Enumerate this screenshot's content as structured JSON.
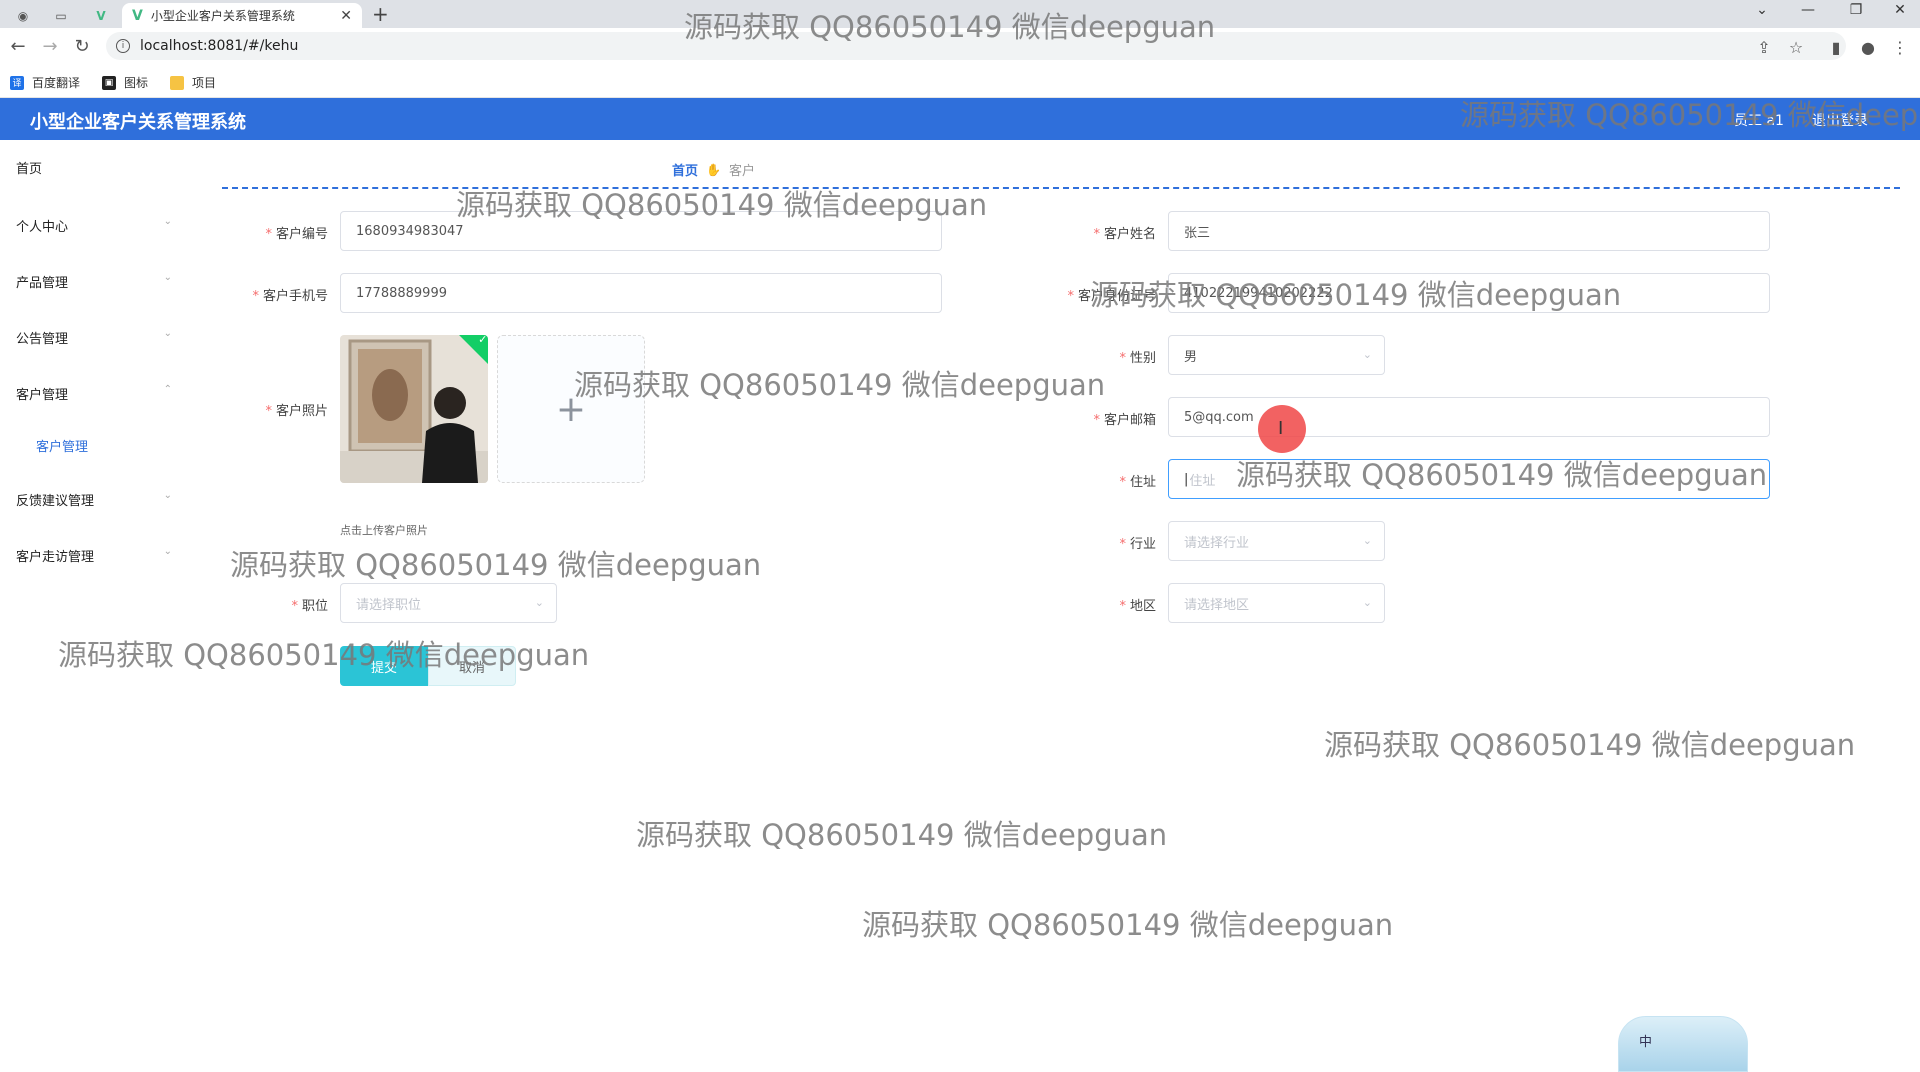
{
  "browser": {
    "tab_title": "小型企业客户关系管理系统",
    "url": "localhost:8081/#/kehu",
    "bookmarks": [
      {
        "label": "百度翻译",
        "icon": "translate-icon",
        "color": "#1f72e8"
      },
      {
        "label": "图标",
        "icon": "iconfont-icon",
        "color": "#222222"
      },
      {
        "label": "项目",
        "icon": "folder-icon",
        "color": "#f6c343"
      }
    ]
  },
  "app": {
    "title": "小型企业客户关系管理系统",
    "user": "员工 a1",
    "logout": "退出登录",
    "accent": "#2f6fdb"
  },
  "sidebar": {
    "items": [
      {
        "label": "首页"
      },
      {
        "label": "个人中心"
      },
      {
        "label": "产品管理"
      },
      {
        "label": "公告管理"
      },
      {
        "label": "客户管理"
      },
      {
        "label": "客户管理"
      },
      {
        "label": "反馈建议管理"
      },
      {
        "label": "客户走访管理"
      }
    ]
  },
  "breadcrumb": {
    "home": "首页",
    "current": "客户"
  },
  "form": {
    "customer_no": {
      "label": "客户编号",
      "value": "1680934983047"
    },
    "customer_name": {
      "label": "客户姓名",
      "value": "张三"
    },
    "phone": {
      "label": "客户手机号",
      "value": "17788889999"
    },
    "id_card": {
      "label": "客户身份证号",
      "value": "410222199410202222"
    },
    "gender": {
      "label": "性别",
      "value": "男"
    },
    "photo": {
      "label": "客户照片",
      "hint": "点击上传客户照片"
    },
    "email": {
      "label": "客户邮箱",
      "value": "5@qq.com"
    },
    "address": {
      "label": "住址",
      "placeholder": "住址"
    },
    "industry": {
      "label": "行业",
      "placeholder": "请选择行业"
    },
    "position": {
      "label": "职位",
      "placeholder": "请选择职位"
    },
    "region": {
      "label": "地区",
      "placeholder": "请选择地区"
    },
    "submit": "提交",
    "cancel": "取消"
  },
  "watermark": "源码获取 QQ86050149 微信deepguan",
  "ime": {
    "label": "中"
  }
}
